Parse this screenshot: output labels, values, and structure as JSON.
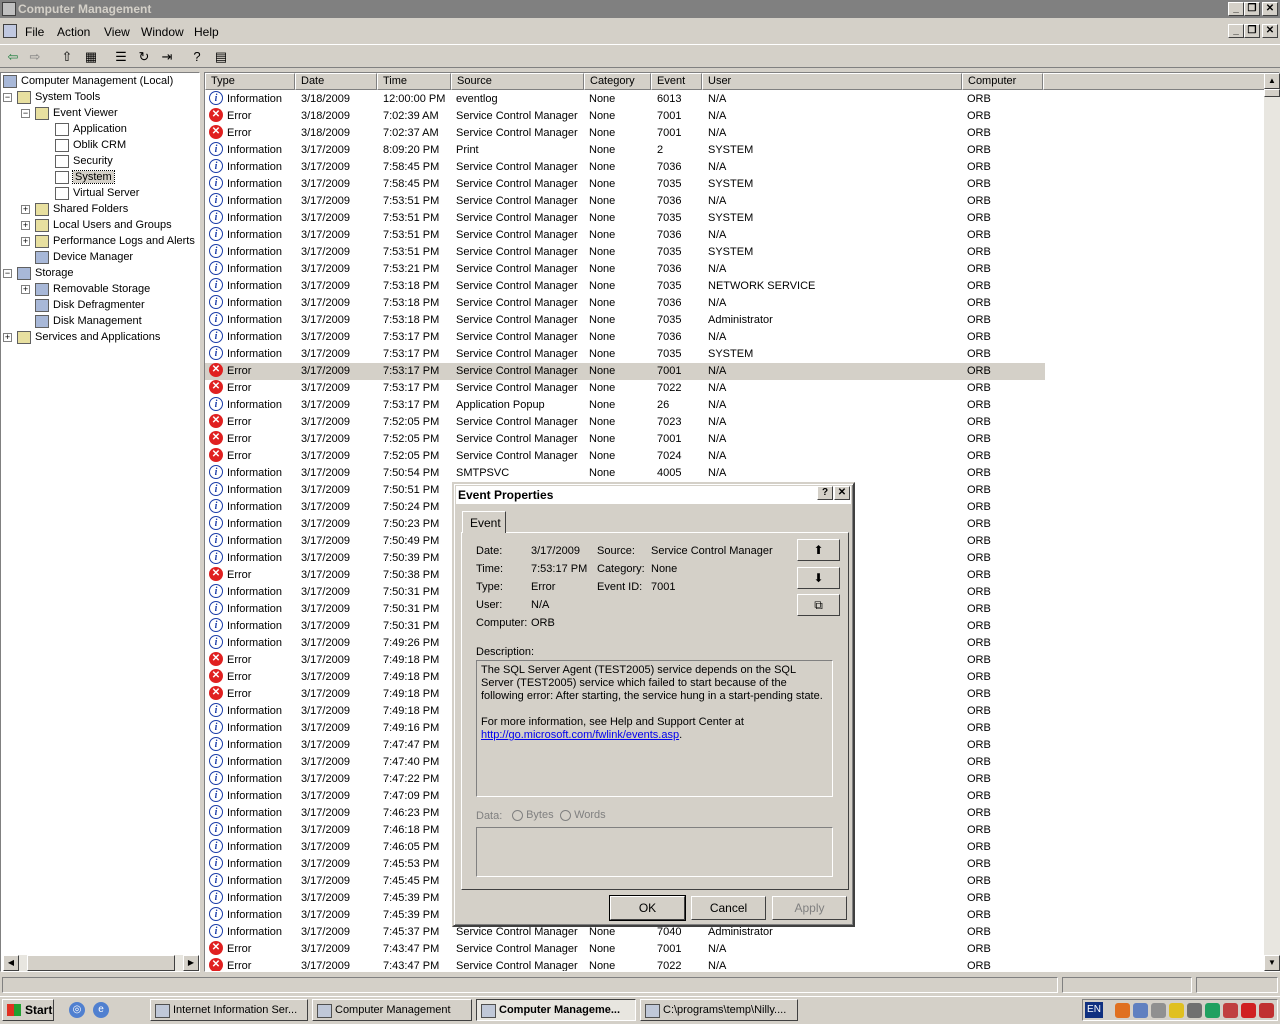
{
  "title": "Computer Management",
  "menu": {
    "file": "File",
    "action": "Action",
    "view": "View",
    "window": "Window",
    "help": "Help"
  },
  "tree": {
    "root": "Computer Management (Local)",
    "system_tools": "System Tools",
    "event_viewer": "Event Viewer",
    "application": "Application",
    "oblik_crm": "Oblik CRM",
    "security": "Security",
    "system": "System",
    "virtual_server": "Virtual Server",
    "shared_folders": "Shared Folders",
    "local_users": "Local Users and Groups",
    "perf_logs": "Performance Logs and Alerts",
    "device_manager": "Device Manager",
    "storage": "Storage",
    "removable_storage": "Removable Storage",
    "disk_defrag": "Disk Defragmenter",
    "disk_mgmt": "Disk Management",
    "services_apps": "Services and Applications"
  },
  "columns": [
    "Type",
    "Date",
    "Time",
    "Source",
    "Category",
    "Event",
    "User",
    "Computer"
  ],
  "rows": [
    [
      "Information",
      "3/18/2009",
      "12:00:00 PM",
      "eventlog",
      "None",
      "6013",
      "N/A",
      "ORB"
    ],
    [
      "Error",
      "3/18/2009",
      "7:02:39 AM",
      "Service Control Manager",
      "None",
      "7001",
      "N/A",
      "ORB"
    ],
    [
      "Error",
      "3/18/2009",
      "7:02:37 AM",
      "Service Control Manager",
      "None",
      "7001",
      "N/A",
      "ORB"
    ],
    [
      "Information",
      "3/17/2009",
      "8:09:20 PM",
      "Print",
      "None",
      "2",
      "SYSTEM",
      "ORB"
    ],
    [
      "Information",
      "3/17/2009",
      "7:58:45 PM",
      "Service Control Manager",
      "None",
      "7036",
      "N/A",
      "ORB"
    ],
    [
      "Information",
      "3/17/2009",
      "7:58:45 PM",
      "Service Control Manager",
      "None",
      "7035",
      "SYSTEM",
      "ORB"
    ],
    [
      "Information",
      "3/17/2009",
      "7:53:51 PM",
      "Service Control Manager",
      "None",
      "7036",
      "N/A",
      "ORB"
    ],
    [
      "Information",
      "3/17/2009",
      "7:53:51 PM",
      "Service Control Manager",
      "None",
      "7035",
      "SYSTEM",
      "ORB"
    ],
    [
      "Information",
      "3/17/2009",
      "7:53:51 PM",
      "Service Control Manager",
      "None",
      "7036",
      "N/A",
      "ORB"
    ],
    [
      "Information",
      "3/17/2009",
      "7:53:51 PM",
      "Service Control Manager",
      "None",
      "7035",
      "SYSTEM",
      "ORB"
    ],
    [
      "Information",
      "3/17/2009",
      "7:53:21 PM",
      "Service Control Manager",
      "None",
      "7036",
      "N/A",
      "ORB"
    ],
    [
      "Information",
      "3/17/2009",
      "7:53:18 PM",
      "Service Control Manager",
      "None",
      "7035",
      "NETWORK SERVICE",
      "ORB"
    ],
    [
      "Information",
      "3/17/2009",
      "7:53:18 PM",
      "Service Control Manager",
      "None",
      "7036",
      "N/A",
      "ORB"
    ],
    [
      "Information",
      "3/17/2009",
      "7:53:18 PM",
      "Service Control Manager",
      "None",
      "7035",
      "Administrator",
      "ORB"
    ],
    [
      "Information",
      "3/17/2009",
      "7:53:17 PM",
      "Service Control Manager",
      "None",
      "7036",
      "N/A",
      "ORB"
    ],
    [
      "Information",
      "3/17/2009",
      "7:53:17 PM",
      "Service Control Manager",
      "None",
      "7035",
      "SYSTEM",
      "ORB"
    ],
    [
      "Error",
      "3/17/2009",
      "7:53:17 PM",
      "Service Control Manager",
      "None",
      "7001",
      "N/A",
      "ORB"
    ],
    [
      "Error",
      "3/17/2009",
      "7:53:17 PM",
      "Service Control Manager",
      "None",
      "7022",
      "N/A",
      "ORB"
    ],
    [
      "Information",
      "3/17/2009",
      "7:53:17 PM",
      "Application Popup",
      "None",
      "26",
      "N/A",
      "ORB"
    ],
    [
      "Error",
      "3/17/2009",
      "7:52:05 PM",
      "Service Control Manager",
      "None",
      "7023",
      "N/A",
      "ORB"
    ],
    [
      "Error",
      "3/17/2009",
      "7:52:05 PM",
      "Service Control Manager",
      "None",
      "7001",
      "N/A",
      "ORB"
    ],
    [
      "Error",
      "3/17/2009",
      "7:52:05 PM",
      "Service Control Manager",
      "None",
      "7024",
      "N/A",
      "ORB"
    ],
    [
      "Information",
      "3/17/2009",
      "7:50:54 PM",
      "SMTPSVC",
      "None",
      "4005",
      "N/A",
      "ORB"
    ],
    [
      "Information",
      "3/17/2009",
      "7:50:51 PM",
      "",
      "",
      "",
      "",
      "ORB"
    ],
    [
      "Information",
      "3/17/2009",
      "7:50:24 PM",
      "",
      "",
      "",
      "",
      "ORB"
    ],
    [
      "Information",
      "3/17/2009",
      "7:50:23 PM",
      "",
      "",
      "",
      "",
      "ORB"
    ],
    [
      "Information",
      "3/17/2009",
      "7:50:49 PM",
      "",
      "",
      "",
      "",
      "ORB"
    ],
    [
      "Information",
      "3/17/2009",
      "7:50:39 PM",
      "",
      "",
      "",
      "",
      "ORB"
    ],
    [
      "Error",
      "3/17/2009",
      "7:50:38 PM",
      "",
      "",
      "",
      "",
      "ORB"
    ],
    [
      "Information",
      "3/17/2009",
      "7:50:31 PM",
      "",
      "",
      "",
      "",
      "ORB"
    ],
    [
      "Information",
      "3/17/2009",
      "7:50:31 PM",
      "",
      "",
      "",
      "",
      "ORB"
    ],
    [
      "Information",
      "3/17/2009",
      "7:50:31 PM",
      "",
      "",
      "",
      "",
      "ORB"
    ],
    [
      "Information",
      "3/17/2009",
      "7:49:26 PM",
      "",
      "",
      "",
      "",
      "ORB"
    ],
    [
      "Error",
      "3/17/2009",
      "7:49:18 PM",
      "",
      "",
      "",
      "",
      "ORB"
    ],
    [
      "Error",
      "3/17/2009",
      "7:49:18 PM",
      "",
      "",
      "",
      "",
      "ORB"
    ],
    [
      "Error",
      "3/17/2009",
      "7:49:18 PM",
      "",
      "",
      "",
      "",
      "ORB"
    ],
    [
      "Information",
      "3/17/2009",
      "7:49:18 PM",
      "",
      "",
      "",
      "",
      "ORB"
    ],
    [
      "Information",
      "3/17/2009",
      "7:49:16 PM",
      "",
      "",
      "",
      "",
      "ORB"
    ],
    [
      "Information",
      "3/17/2009",
      "7:47:47 PM",
      "",
      "",
      "",
      "",
      "ORB"
    ],
    [
      "Information",
      "3/17/2009",
      "7:47:40 PM",
      "",
      "",
      "",
      "",
      "ORB"
    ],
    [
      "Information",
      "3/17/2009",
      "7:47:22 PM",
      "",
      "",
      "",
      "",
      "ORB"
    ],
    [
      "Information",
      "3/17/2009",
      "7:47:09 PM",
      "",
      "",
      "",
      "",
      "ORB"
    ],
    [
      "Information",
      "3/17/2009",
      "7:46:23 PM",
      "",
      "",
      "",
      "",
      "ORB"
    ],
    [
      "Information",
      "3/17/2009",
      "7:46:18 PM",
      "",
      "",
      "",
      "",
      "ORB"
    ],
    [
      "Information",
      "3/17/2009",
      "7:46:05 PM",
      "",
      "",
      "",
      "",
      "ORB"
    ],
    [
      "Information",
      "3/17/2009",
      "7:45:53 PM",
      "",
      "",
      "",
      "",
      "ORB"
    ],
    [
      "Information",
      "3/17/2009",
      "7:45:45 PM",
      "",
      "",
      "",
      "",
      "ORB"
    ],
    [
      "Information",
      "3/17/2009",
      "7:45:39 PM",
      "",
      "",
      "",
      "",
      "ORB"
    ],
    [
      "Information",
      "3/17/2009",
      "7:45:39 PM",
      "",
      "",
      "",
      "",
      "ORB"
    ],
    [
      "Information",
      "3/17/2009",
      "7:45:37 PM",
      "Service Control Manager",
      "None",
      "7040",
      "Administrator",
      "ORB"
    ],
    [
      "Error",
      "3/17/2009",
      "7:43:47 PM",
      "Service Control Manager",
      "None",
      "7001",
      "N/A",
      "ORB"
    ],
    [
      "Error",
      "3/17/2009",
      "7:43:47 PM",
      "Service Control Manager",
      "None",
      "7022",
      "N/A",
      "ORB"
    ]
  ],
  "selected_row": 16,
  "dialog": {
    "title": "Event Properties",
    "tab": "Event",
    "date_label": "Date:",
    "date": "3/17/2009",
    "source_label": "Source:",
    "source": "Service Control Manager",
    "time_label": "Time:",
    "time": "7:53:17 PM",
    "category_label": "Category:",
    "category": "None",
    "type_label": "Type:",
    "type": "Error",
    "eventid_label": "Event ID:",
    "eventid": "7001",
    "user_label": "User:",
    "user": "N/A",
    "computer_label": "Computer:",
    "computer": "ORB",
    "description_label": "Description:",
    "description": "The SQL Server Agent (TEST2005) service depends on the SQL Server (TEST2005) service which failed to start because of the following error: After starting, the service hung in a start-pending state.",
    "more_info": "For more information, see Help and Support Center at",
    "link": "http://go.microsoft.com/fwlink/events.asp",
    "link_suffix": ".",
    "data_label": "Data:",
    "bytes": "Bytes",
    "words": "Words",
    "ok": "OK",
    "cancel": "Cancel",
    "apply": "Apply"
  },
  "taskbar": {
    "start": "Start",
    "tasks": [
      "Internet Information Ser...",
      "Computer Management",
      "Computer Manageme...",
      "C:\\programs\\temp\\Nilly...."
    ],
    "lang": "EN"
  }
}
